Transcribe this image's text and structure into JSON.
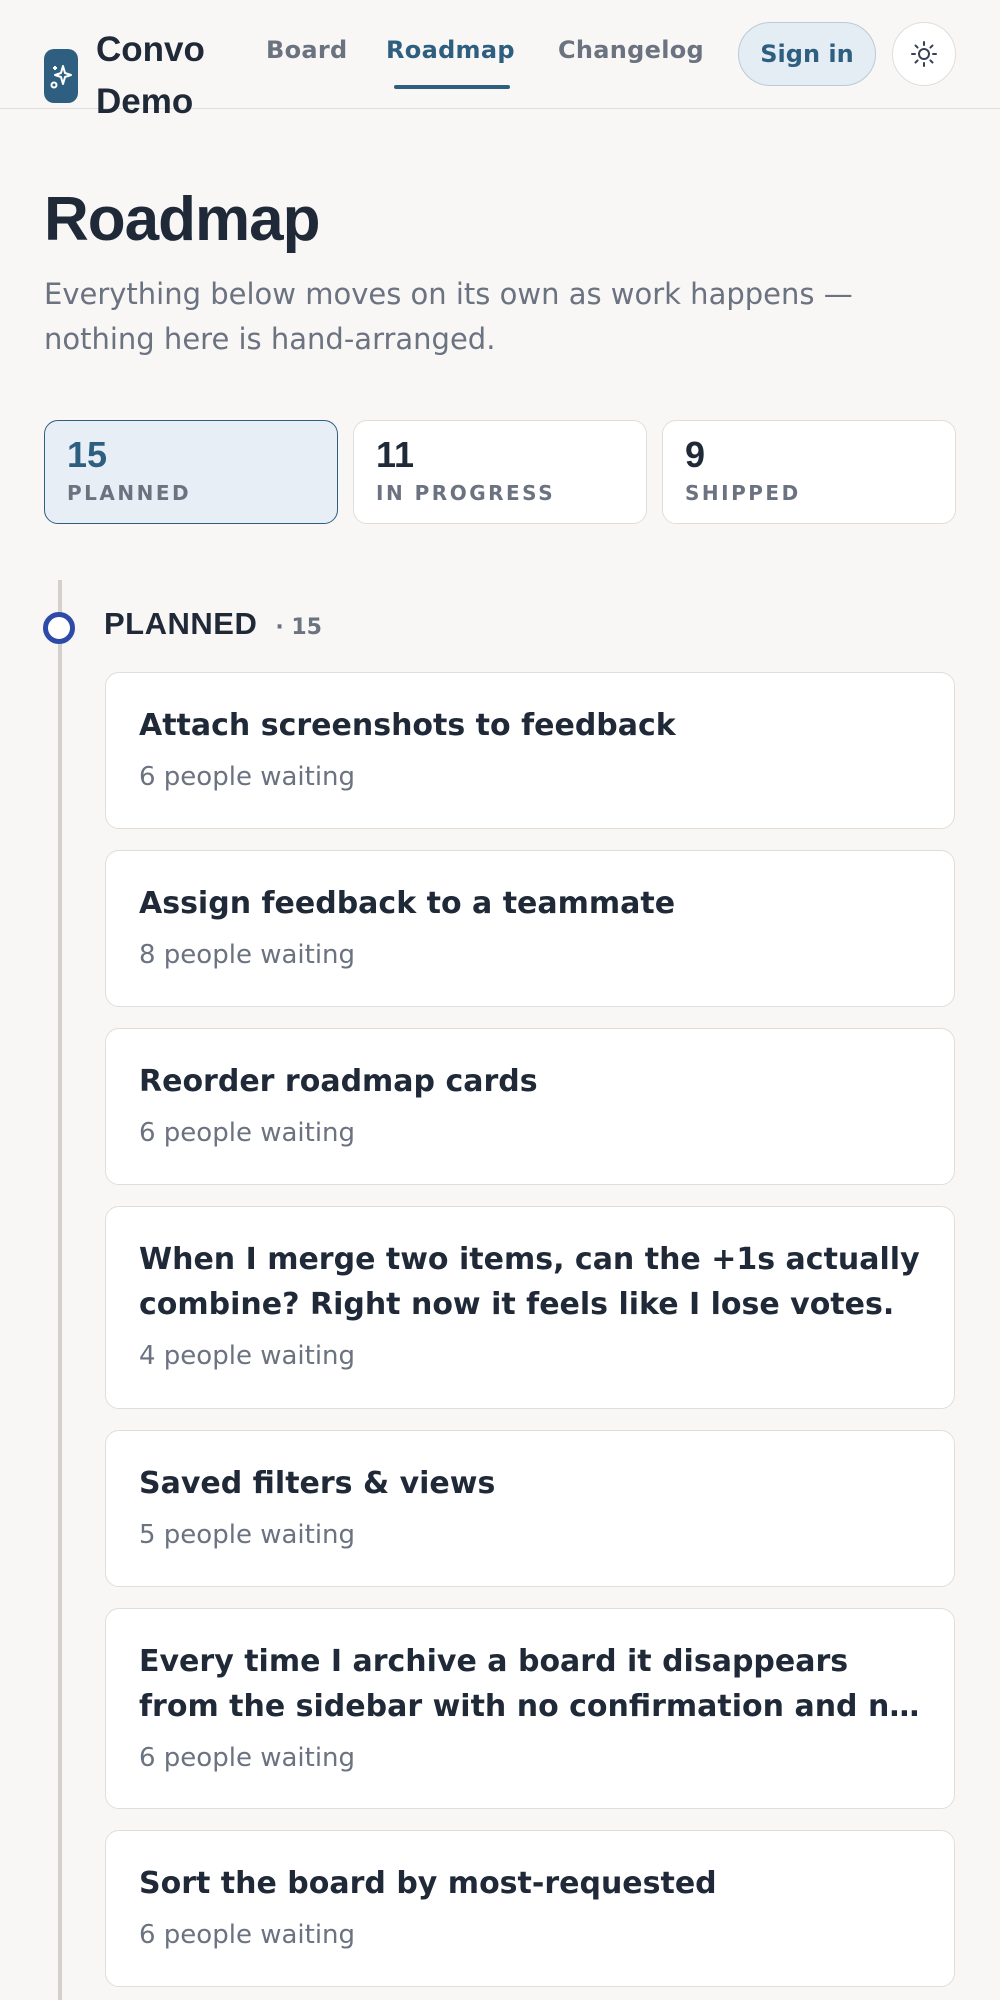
{
  "header": {
    "brand": "Convo Demo",
    "nav": [
      "Board",
      "Roadmap",
      "Changelog"
    ],
    "signin_label": "Sign in",
    "theme_toggle_icon": "sun-icon",
    "logo_icon": "sparkles-icon"
  },
  "page": {
    "title": "Roadmap",
    "subtitle": "Everything below moves on its own as work happens — nothing here is hand-arranged."
  },
  "stats": [
    {
      "count": "15",
      "label": "PLANNED",
      "active": true
    },
    {
      "count": "11",
      "label": "IN PROGRESS",
      "active": false
    },
    {
      "count": "9",
      "label": "SHIPPED",
      "active": false
    }
  ],
  "section": {
    "title": "PLANNED",
    "count": "· 15",
    "items": [
      {
        "title": "Attach screenshots to feedback",
        "waiting": "6 people waiting"
      },
      {
        "title": "Assign feedback to a teammate",
        "waiting": "8 people waiting"
      },
      {
        "title": "Reorder roadmap cards",
        "waiting": "6 people waiting"
      },
      {
        "title": "When I merge two items, can the +1s actually combine? Right now it feels like I lose votes.",
        "waiting": "4 people waiting"
      },
      {
        "title": "Saved filters & views",
        "waiting": "5 people waiting"
      },
      {
        "title": "Every time I archive a board it disappears from the sidebar with no confirmation and no way to get it back.",
        "waiting": "6 people waiting"
      },
      {
        "title": "Sort the board by most-requested",
        "waiting": "6 people waiting"
      }
    ]
  },
  "colors": {
    "accent": "#2f5f80",
    "timeline_dot": "#2e4aa8",
    "background": "#f8f7f5"
  }
}
